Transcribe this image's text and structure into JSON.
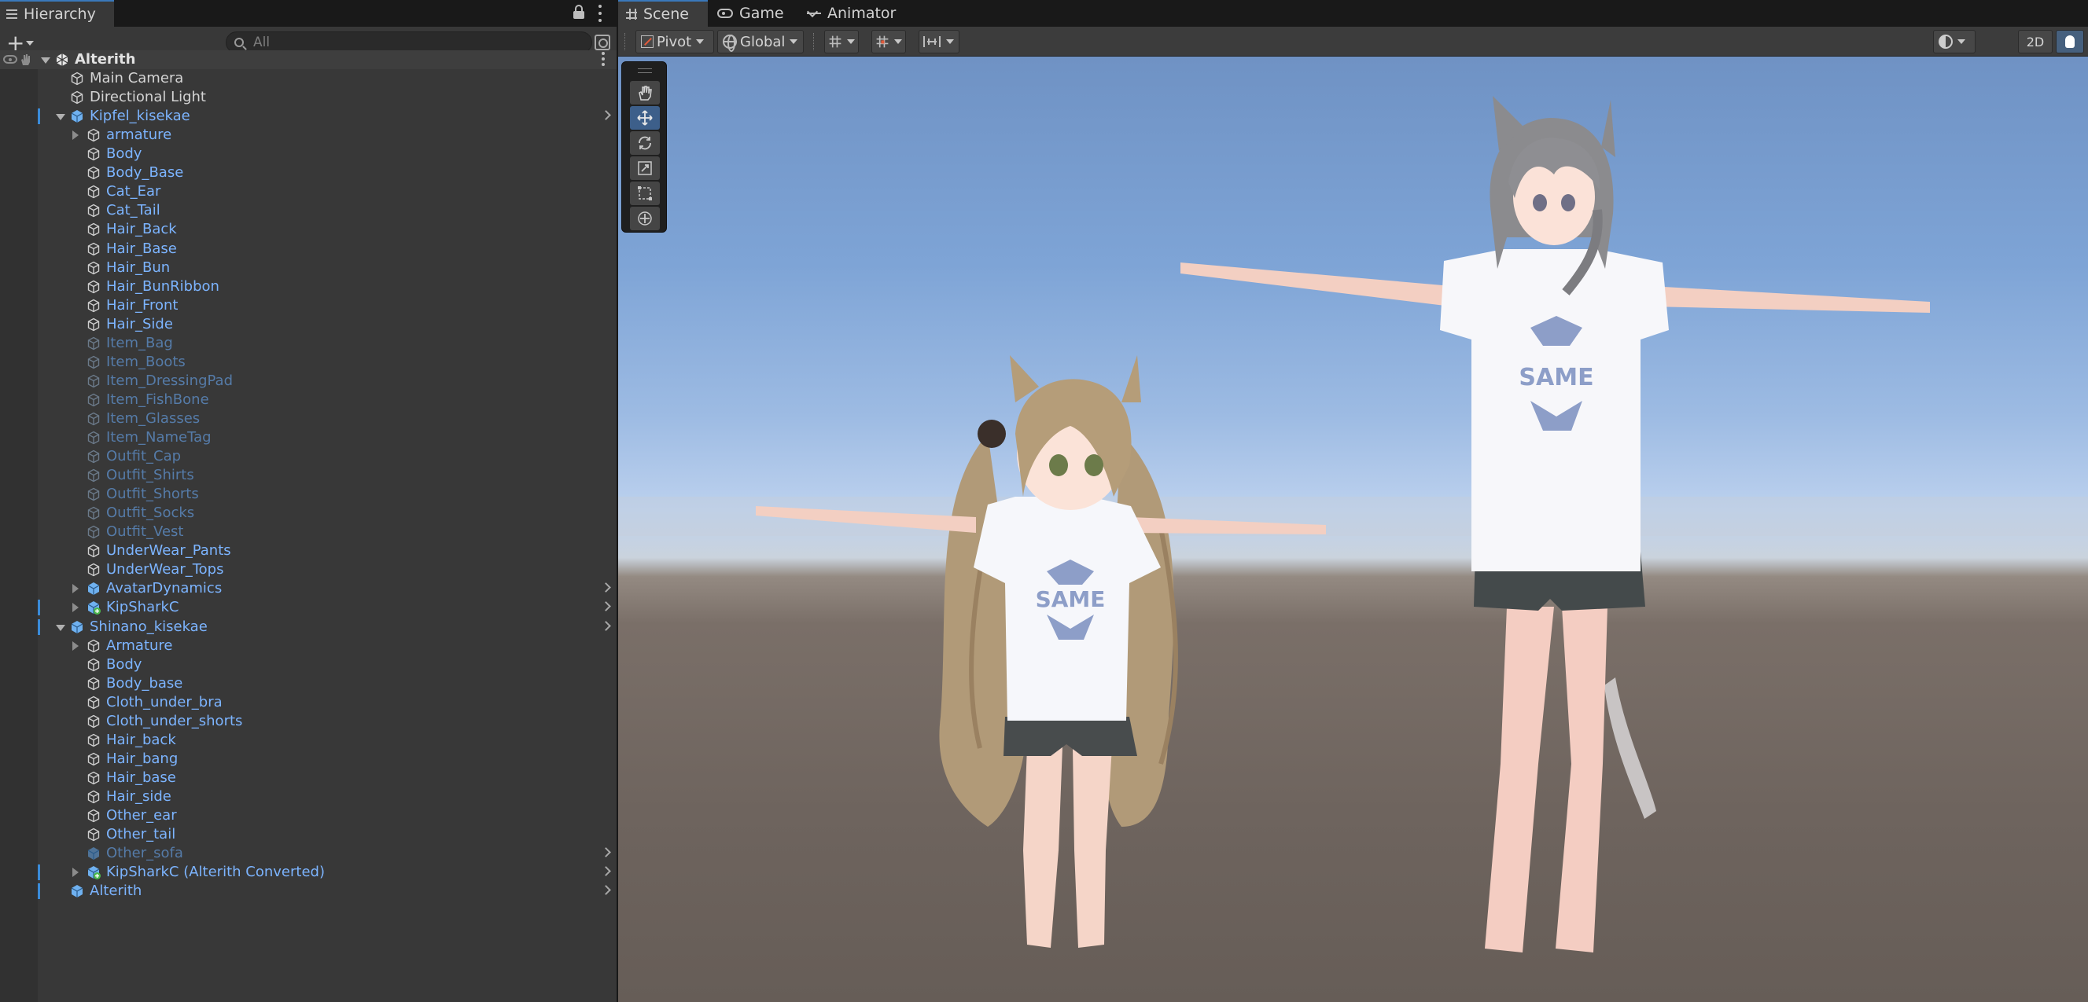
{
  "hierarchy": {
    "tab_label": "Hierarchy",
    "add_symbol": "+",
    "search_placeholder": "All",
    "rows": [
      {
        "label": "Alterith",
        "kind": "root",
        "depth": 0,
        "fold": "open"
      },
      {
        "label": "Main Camera",
        "kind": "normal",
        "depth": 1,
        "fold": "none",
        "icon": "gameobject"
      },
      {
        "label": "Directional Light",
        "kind": "normal",
        "depth": 1,
        "fold": "none",
        "icon": "gameobject"
      },
      {
        "label": "Kipfel_kisekae",
        "kind": "blue",
        "depth": 1,
        "fold": "open",
        "icon": "prefab",
        "chevron": true,
        "mark": true
      },
      {
        "label": "armature",
        "kind": "blue",
        "depth": 2,
        "fold": "closed",
        "icon": "gameobject"
      },
      {
        "label": "Body",
        "kind": "blue",
        "depth": 2,
        "fold": "none",
        "icon": "gameobject"
      },
      {
        "label": "Body_Base",
        "kind": "blue",
        "depth": 2,
        "fold": "none",
        "icon": "gameobject"
      },
      {
        "label": "Cat_Ear",
        "kind": "blue",
        "depth": 2,
        "fold": "none",
        "icon": "gameobject"
      },
      {
        "label": "Cat_Tail",
        "kind": "blue",
        "depth": 2,
        "fold": "none",
        "icon": "gameobject"
      },
      {
        "label": "Hair_Back",
        "kind": "blue",
        "depth": 2,
        "fold": "none",
        "icon": "gameobject"
      },
      {
        "label": "Hair_Base",
        "kind": "blue",
        "depth": 2,
        "fold": "none",
        "icon": "gameobject"
      },
      {
        "label": "Hair_Bun",
        "kind": "blue",
        "depth": 2,
        "fold": "none",
        "icon": "gameobject"
      },
      {
        "label": "Hair_BunRibbon",
        "kind": "blue",
        "depth": 2,
        "fold": "none",
        "icon": "gameobject"
      },
      {
        "label": "Hair_Front",
        "kind": "blue",
        "depth": 2,
        "fold": "none",
        "icon": "gameobject"
      },
      {
        "label": "Hair_Side",
        "kind": "blue",
        "depth": 2,
        "fold": "none",
        "icon": "gameobject"
      },
      {
        "label": "Item_Bag",
        "kind": "dim",
        "depth": 2,
        "fold": "none",
        "icon": "gameobject"
      },
      {
        "label": "Item_Boots",
        "kind": "dim",
        "depth": 2,
        "fold": "none",
        "icon": "gameobject"
      },
      {
        "label": "Item_DressingPad",
        "kind": "dim",
        "depth": 2,
        "fold": "none",
        "icon": "gameobject"
      },
      {
        "label": "Item_FishBone",
        "kind": "dim",
        "depth": 2,
        "fold": "none",
        "icon": "gameobject"
      },
      {
        "label": "Item_Glasses",
        "kind": "dim",
        "depth": 2,
        "fold": "none",
        "icon": "gameobject"
      },
      {
        "label": "Item_NameTag",
        "kind": "dim",
        "depth": 2,
        "fold": "none",
        "icon": "gameobject"
      },
      {
        "label": "Outfit_Cap",
        "kind": "dim",
        "depth": 2,
        "fold": "none",
        "icon": "gameobject"
      },
      {
        "label": "Outfit_Shirts",
        "kind": "dim",
        "depth": 2,
        "fold": "none",
        "icon": "gameobject"
      },
      {
        "label": "Outfit_Shorts",
        "kind": "dim",
        "depth": 2,
        "fold": "none",
        "icon": "gameobject"
      },
      {
        "label": "Outfit_Socks",
        "kind": "dim",
        "depth": 2,
        "fold": "none",
        "icon": "gameobject"
      },
      {
        "label": "Outfit_Vest",
        "kind": "dim",
        "depth": 2,
        "fold": "none",
        "icon": "gameobject"
      },
      {
        "label": "UnderWear_Pants",
        "kind": "blue",
        "depth": 2,
        "fold": "none",
        "icon": "gameobject"
      },
      {
        "label": "UnderWear_Tops",
        "kind": "blue",
        "depth": 2,
        "fold": "none",
        "icon": "gameobject"
      },
      {
        "label": "AvatarDynamics",
        "kind": "blue",
        "depth": 2,
        "fold": "closed",
        "icon": "prefab",
        "chevron": true
      },
      {
        "label": "KipSharkC",
        "kind": "blue",
        "depth": 2,
        "fold": "closed",
        "icon": "prefab-added",
        "chevron": true,
        "mark": true
      },
      {
        "label": "Shinano_kisekae",
        "kind": "blue",
        "depth": 1,
        "fold": "open",
        "icon": "prefab",
        "chevron": true,
        "mark": true
      },
      {
        "label": "Armature",
        "kind": "blue",
        "depth": 2,
        "fold": "closed",
        "icon": "gameobject"
      },
      {
        "label": "Body",
        "kind": "blue",
        "depth": 2,
        "fold": "none",
        "icon": "gameobject"
      },
      {
        "label": "Body_base",
        "kind": "blue",
        "depth": 2,
        "fold": "none",
        "icon": "gameobject"
      },
      {
        "label": "Cloth_under_bra",
        "kind": "blue",
        "depth": 2,
        "fold": "none",
        "icon": "gameobject"
      },
      {
        "label": "Cloth_under_shorts",
        "kind": "blue",
        "depth": 2,
        "fold": "none",
        "icon": "gameobject"
      },
      {
        "label": "Hair_back",
        "kind": "blue",
        "depth": 2,
        "fold": "none",
        "icon": "gameobject"
      },
      {
        "label": "Hair_bang",
        "kind": "blue",
        "depth": 2,
        "fold": "none",
        "icon": "gameobject"
      },
      {
        "label": "Hair_base",
        "kind": "blue",
        "depth": 2,
        "fold": "none",
        "icon": "gameobject"
      },
      {
        "label": "Hair_side",
        "kind": "blue",
        "depth": 2,
        "fold": "none",
        "icon": "gameobject"
      },
      {
        "label": "Other_ear",
        "kind": "blue",
        "depth": 2,
        "fold": "none",
        "icon": "gameobject"
      },
      {
        "label": "Other_tail",
        "kind": "blue",
        "depth": 2,
        "fold": "none",
        "icon": "gameobject"
      },
      {
        "label": "Other_sofa",
        "kind": "dim",
        "depth": 2,
        "fold": "none",
        "icon": "prefab-dim",
        "chevron": true
      },
      {
        "label": "KipSharkC (Alterith Converted)",
        "kind": "blue",
        "depth": 2,
        "fold": "closed",
        "icon": "prefab-added",
        "chevron": true,
        "mark": true
      },
      {
        "label": "Alterith",
        "kind": "blue",
        "depth": 1,
        "fold": "none",
        "icon": "prefab",
        "chevron": true,
        "mark": true
      }
    ]
  },
  "scene": {
    "tabs": [
      {
        "label": "Scene",
        "icon": "grid-icon",
        "active": true
      },
      {
        "label": "Game",
        "icon": "gamepad-icon",
        "active": false
      },
      {
        "label": "Animator",
        "icon": "animator-icon",
        "active": false
      }
    ],
    "toolbar": {
      "pivot_label": "Pivot",
      "global_label": "Global",
      "mode_2d_label": "2D"
    },
    "tools": [
      "hand-tool",
      "move-tool",
      "rotate-tool",
      "scale-tool",
      "rect-tool",
      "transform-tool"
    ],
    "active_tool": "move-tool",
    "shirt_text": "SAME"
  },
  "colors": {
    "accent_blue": "#7cb4ff",
    "dim_blue": "#557ba8",
    "selection_mark": "#3a8bd8",
    "panel_bg": "#383838"
  }
}
